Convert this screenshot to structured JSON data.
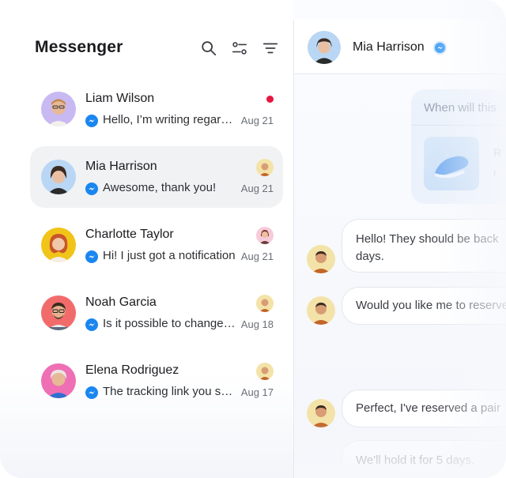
{
  "app": {
    "title": "Messenger"
  },
  "header_icons": [
    "search-icon",
    "sliders-icon",
    "filter-icon"
  ],
  "conversations": [
    {
      "name": "Liam Wilson",
      "preview": "Hello, I’m writing regarding my order",
      "date": "Aug 21",
      "indicator": "unread-dot"
    },
    {
      "name": "Mia Harrison",
      "preview": "Awesome, thank you!",
      "date": "Aug 21",
      "indicator": "agent-avatar",
      "active": true
    },
    {
      "name": "Charlotte Taylor",
      "preview": "Hi! I just got a notification",
      "date": "Aug 21",
      "indicator": "agent-avatar"
    },
    {
      "name": "Noah Garcia",
      "preview": "Is it possible to change my order",
      "date": "Aug 18",
      "indicator": "agent-avatar"
    },
    {
      "name": "Elena Rodriguez",
      "preview": "The tracking link you sent",
      "date": "Aug 17",
      "indicator": "agent-avatar"
    }
  ],
  "chat": {
    "contact_name": "Mia Harrison",
    "contact_badge_icon": "messenger-icon",
    "outgoing": {
      "text": "When will this",
      "product_title": "R",
      "product_subtitle": "r"
    },
    "messages": [
      {
        "text": "Hello! They should be back",
        "text2": "days."
      },
      {
        "text": "Would you like me to reserve"
      },
      {
        "text": "Perfect, I've reserved a pair"
      },
      {
        "text": "We'll hold it for 5 days."
      }
    ]
  },
  "colors": {
    "accent": "#1a86f0",
    "unread": "#e5173f",
    "active_row": "#f1f2f4"
  }
}
